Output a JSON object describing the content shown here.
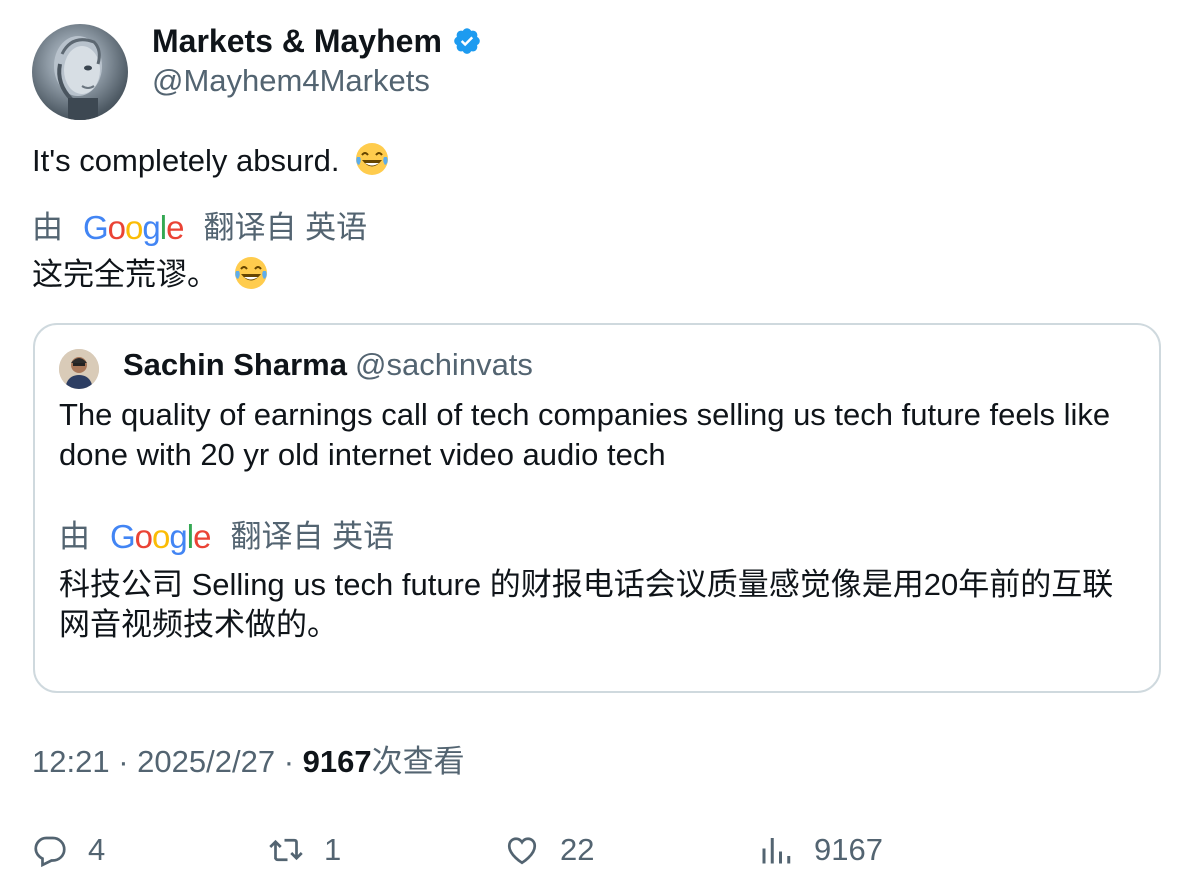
{
  "author": {
    "name": "Markets & Mayhem",
    "handle": "@Mayhem4Markets",
    "verified": true
  },
  "tweet": {
    "text": "It's completely absurd.",
    "emoji": "😂"
  },
  "translation": {
    "prefix": "由",
    "provider": "Google",
    "suffix": "翻译自 英语",
    "text": "这完全荒谬。",
    "emoji": "😂"
  },
  "quote": {
    "name": "Sachin Sharma",
    "handle": "@sachinvats",
    "text": "The quality of earnings call of tech companies selling us tech future feels like done with 20 yr old internet video audio tech",
    "translation_prefix": "由",
    "translation_provider": "Google",
    "translation_suffix": "翻译自 英语",
    "translation_text": "科技公司 Selling us tech future 的财报电话会议质量感觉像是用20年前的互联网音视频技术做的。"
  },
  "meta": {
    "time": "12:21",
    "separator": "·",
    "date": "2025/2/27",
    "views_count": "9167",
    "views_label": "次查看"
  },
  "actions": {
    "replies": "4",
    "retweets": "1",
    "likes": "22",
    "views": "9167"
  },
  "colors": {
    "text": "#0f1419",
    "secondary": "#536471",
    "verified": "#1d9bf0",
    "border": "#cfd9de",
    "google_blue": "#4285F4",
    "google_red": "#EA4335",
    "google_yellow": "#FBBC05",
    "google_green": "#34A853"
  }
}
